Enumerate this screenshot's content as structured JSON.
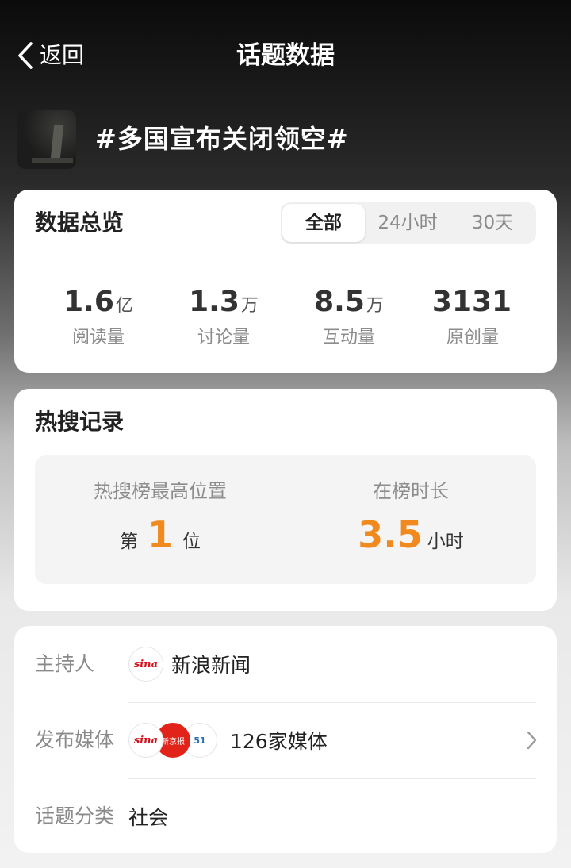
{
  "header": {
    "back_label": "返回",
    "title": "话题数据"
  },
  "topic": {
    "title": "#多国宣布关闭领空#"
  },
  "overview": {
    "title": "数据总览",
    "tabs": [
      {
        "label": "全部",
        "active": true
      },
      {
        "label": "24小时",
        "active": false
      },
      {
        "label": "30天",
        "active": false
      }
    ],
    "stats": [
      {
        "value": "1.6",
        "unit": "亿",
        "label": "阅读量"
      },
      {
        "value": "1.3",
        "unit": "万",
        "label": "讨论量"
      },
      {
        "value": "8.5",
        "unit": "万",
        "label": "互动量"
      },
      {
        "value": "3131",
        "unit": "",
        "label": "原创量"
      }
    ]
  },
  "hot_search": {
    "title": "热搜记录",
    "peak": {
      "label": "热搜榜最高位置",
      "prefix": "第",
      "value": "1",
      "suffix": "位"
    },
    "duration": {
      "label": "在榜时长",
      "value": "3.5",
      "suffix": "小时"
    },
    "accent_color": "#f08a1e"
  },
  "info": {
    "host": {
      "label": "主持人",
      "value": "新浪新闻",
      "logo": "sina-logo",
      "logo_text": "sina"
    },
    "media": {
      "label": "发布媒体",
      "value": "126家媒体",
      "logos": [
        "sina-logo",
        "newspaper-logo",
        "media-logo"
      ],
      "logo_texts": [
        "sina",
        "新京报",
        "51"
      ]
    },
    "category": {
      "label": "话题分类",
      "value": "社会"
    }
  }
}
